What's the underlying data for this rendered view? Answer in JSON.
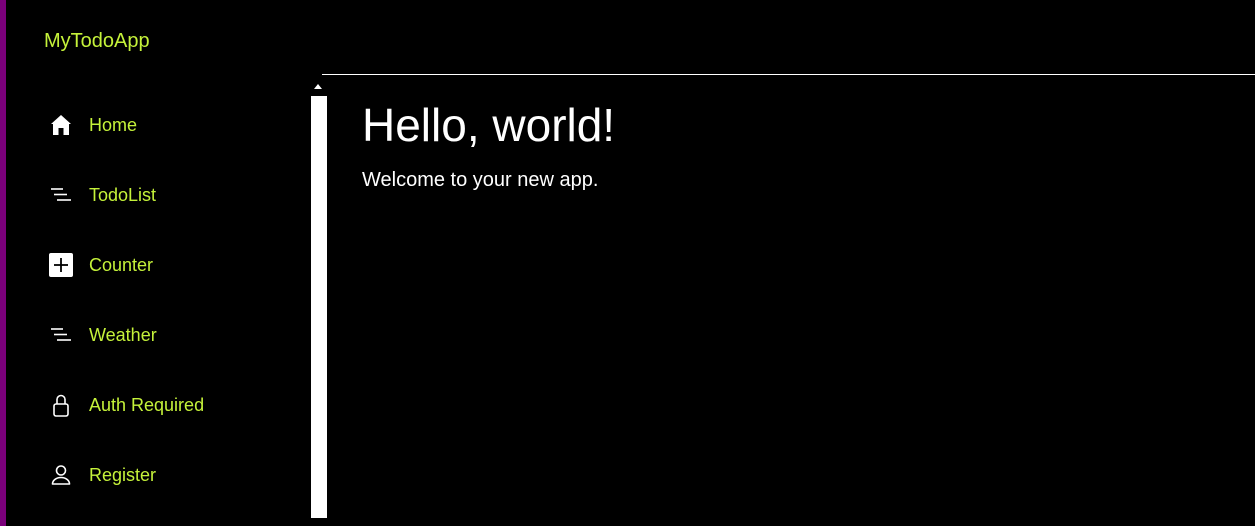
{
  "app": {
    "brand": "MyTodoApp",
    "accent_color": "#c5f23a"
  },
  "sidebar": {
    "items": [
      {
        "label": "Home",
        "icon": "home-icon"
      },
      {
        "label": "TodoList",
        "icon": "list-icon"
      },
      {
        "label": "Counter",
        "icon": "plus-square-icon"
      },
      {
        "label": "Weather",
        "icon": "list-icon"
      },
      {
        "label": "Auth Required",
        "icon": "lock-icon"
      },
      {
        "label": "Register",
        "icon": "user-icon"
      }
    ]
  },
  "main": {
    "title": "Hello, world!",
    "text": "Welcome to your new app."
  }
}
